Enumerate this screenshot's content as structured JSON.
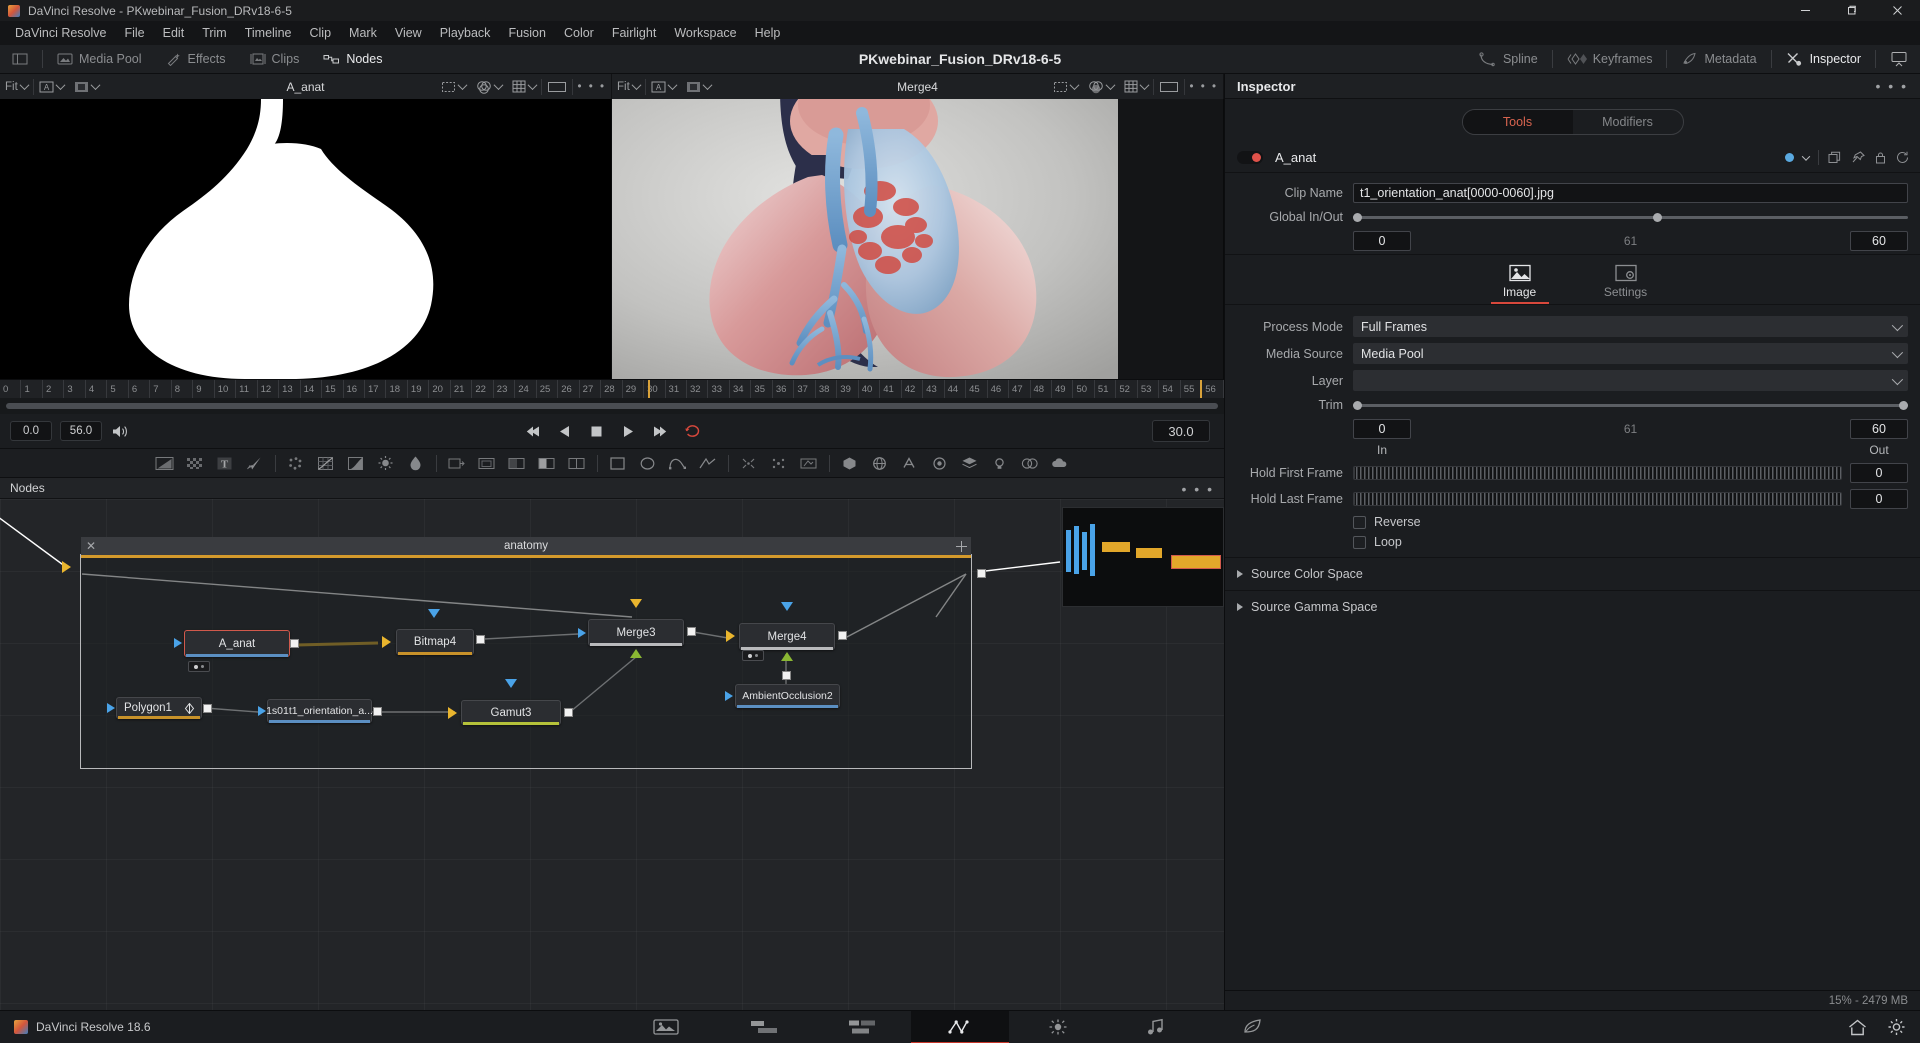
{
  "window": {
    "title": "DaVinci Resolve - PKwebinar_Fusion_DRv18-6-5",
    "minimize": "–",
    "maximize": "▢",
    "close": "✕"
  },
  "menubar": {
    "items": [
      "DaVinci Resolve",
      "File",
      "Edit",
      "Trim",
      "Timeline",
      "Clip",
      "Mark",
      "View",
      "Playback",
      "Fusion",
      "Color",
      "Fairlight",
      "Workspace",
      "Help"
    ]
  },
  "pagebar": {
    "title": "PKwebinar_Fusion_DRv18-6-5",
    "left_buttons": [
      {
        "label": "Media Pool",
        "icon": "media-pool-icon",
        "active": false
      },
      {
        "label": "Effects",
        "icon": "effects-icon",
        "active": false
      },
      {
        "label": "Clips",
        "icon": "clips-icon",
        "active": false
      },
      {
        "label": "Nodes",
        "icon": "nodes-icon",
        "active": true
      }
    ],
    "right_buttons": [
      {
        "label": "Spline",
        "icon": "spline-icon",
        "active": false
      },
      {
        "label": "Keyframes",
        "icon": "keyframes-icon",
        "active": false
      },
      {
        "label": "Metadata",
        "icon": "metadata-icon",
        "active": false
      },
      {
        "label": "Inspector",
        "icon": "inspector-icon",
        "active": true
      }
    ],
    "ui_toggle_icon": "ui-layout-icon"
  },
  "viewers": {
    "left": {
      "title": "A_anat",
      "fit_label": "Fit",
      "controls": [
        "fit-dropdown",
        "viewer-a-button",
        "display-mode-button",
        "more-options"
      ]
    },
    "right": {
      "title": "Merge4",
      "fit_label": "Fit",
      "controls": [
        "fit-dropdown",
        "viewer-b-button",
        "roi-button",
        "color-button",
        "grid-button",
        "frame-button",
        "more-options"
      ]
    }
  },
  "timeline": {
    "ticks": [
      "0",
      "1",
      "2",
      "3",
      "4",
      "5",
      "6",
      "7",
      "8",
      "9",
      "10",
      "11",
      "12",
      "13",
      "14",
      "15",
      "16",
      "17",
      "18",
      "19",
      "20",
      "21",
      "22",
      "23",
      "24",
      "25",
      "26",
      "27",
      "28",
      "29",
      "30",
      "31",
      "32",
      "33",
      "34",
      "35",
      "36",
      "37",
      "38",
      "39",
      "40",
      "41",
      "42",
      "43",
      "44",
      "45",
      "46",
      "47",
      "48",
      "49",
      "50",
      "51",
      "52",
      "53",
      "54",
      "55",
      "56"
    ],
    "playhead_frame": "30"
  },
  "transport": {
    "in_point": "0.0",
    "out_point": "56.0",
    "current_frame": "30.0",
    "audio_icon": "speaker-icon",
    "buttons": [
      "jump-to-start",
      "play-reverse",
      "stop",
      "play-forward",
      "jump-to-end",
      "loop"
    ]
  },
  "tools": {
    "items": [
      "gradient-tool",
      "checker-tool",
      "text-tool",
      "paint-tool",
      "particles-tool",
      "color-curves-tool",
      "levels-tool",
      "brightness-contrast-tool",
      "blur-tool",
      "transform-tool",
      "resize-tool",
      "crop-tool",
      "merge-tool",
      "dissolve-tool",
      "rectangle-mask-tool",
      "ellipse-mask-tool",
      "bspline-mask-tool",
      "polygon-mask-tool",
      "tracker-tool",
      "planar-tracker-tool",
      "stabilizer-tool",
      "3d-shape-tool",
      "3d-sphere-tool",
      "3d-text-tool",
      "3d-camera-tool",
      "3d-render-tool",
      "3d-light-tool",
      "3d-material-tool"
    ]
  },
  "nodes_panel": {
    "header": "Nodes",
    "more_label": "• • •",
    "group": {
      "title": "anatomy",
      "close_icon": "close-icon",
      "resize_icon": "resize-handle-icon"
    },
    "nodes": [
      {
        "id": "a_anat",
        "label": "A_anat",
        "selected": true,
        "underline": "#5b8fc2"
      },
      {
        "id": "bitmap4",
        "label": "Bitmap4",
        "selected": false,
        "underline": "#c8922a"
      },
      {
        "id": "merge3",
        "label": "Merge3",
        "selected": false,
        "underline": "#b9babc"
      },
      {
        "id": "merge4",
        "label": "Merge4",
        "selected": false,
        "underline": "#b9babc"
      },
      {
        "id": "polygon1",
        "label": "Polygon1",
        "selected": false,
        "underline": "#c8922a"
      },
      {
        "id": "loader1",
        "label": "1s01t1_orientation_a...",
        "selected": false,
        "underline": "#5b8fc2"
      },
      {
        "id": "gamut3",
        "label": "Gamut3",
        "selected": false,
        "underline": "#b5c23a"
      },
      {
        "id": "ambientocclusion2",
        "label": "AmbientOcclusion2",
        "selected": false,
        "underline": "#5b8fc2"
      }
    ]
  },
  "inspector": {
    "title": "Inspector",
    "more_label": "• • •",
    "tabs": {
      "tools": "Tools",
      "modifiers": "Modifiers",
      "active": "Tools"
    },
    "node": {
      "name": "A_anat",
      "enabled": true,
      "color_dot": "#5aa9e0",
      "actions": [
        "copy-icon",
        "pin-icon",
        "lock-icon",
        "reset-icon"
      ]
    },
    "clip_name_label": "Clip Name",
    "clip_name_value": "t1_orientation_anat[0000-0060].jpg",
    "global_inout_label": "Global In/Out",
    "global_in": "0",
    "global_length": "61",
    "global_out": "60",
    "subtabs": [
      {
        "label": "Image",
        "icon": "image-icon",
        "active": true
      },
      {
        "label": "Settings",
        "icon": "settings-icon",
        "active": false
      }
    ],
    "process_mode_label": "Process Mode",
    "process_mode_value": "Full Frames",
    "media_source_label": "Media Source",
    "media_source_value": "Media Pool",
    "layer_label": "Layer",
    "layer_value": "",
    "trim_label": "Trim",
    "trim_in": "0",
    "trim_length": "61",
    "trim_out": "60",
    "in_label": "In",
    "out_label": "Out",
    "hold_first_label": "Hold First Frame",
    "hold_first_value": "0",
    "hold_last_label": "Hold Last Frame",
    "hold_last_value": "0",
    "reverse_label": "Reverse",
    "reverse_checked": false,
    "loop_label": "Loop",
    "loop_checked": false,
    "source_color_space": "Source Color Space",
    "source_gamma_space": "Source Gamma Space"
  },
  "statusbar": {
    "text": "15% - 2479 MB"
  },
  "bottombar": {
    "app_name": "DaVinci Resolve 18.6",
    "pages": [
      {
        "name": "media-page",
        "icon": "media-page-icon",
        "active": false
      },
      {
        "name": "cut-page",
        "icon": "cut-page-icon",
        "active": false
      },
      {
        "name": "edit-page",
        "icon": "edit-page-icon",
        "active": false
      },
      {
        "name": "fusion-page",
        "icon": "fusion-page-icon",
        "active": true
      },
      {
        "name": "color-page",
        "icon": "color-page-icon",
        "active": false
      },
      {
        "name": "fairlight-page",
        "icon": "fairlight-page-icon",
        "active": false
      },
      {
        "name": "deliver-page",
        "icon": "deliver-page-icon",
        "active": false
      }
    ],
    "right_icons": [
      "home-icon",
      "settings-icon"
    ]
  },
  "colors": {
    "accent_red": "#d8483c",
    "node_yellow": "#e9b52e",
    "port_blue": "#4aa3e8",
    "port_green": "#8ab733",
    "group_border": "#d49a2c"
  }
}
